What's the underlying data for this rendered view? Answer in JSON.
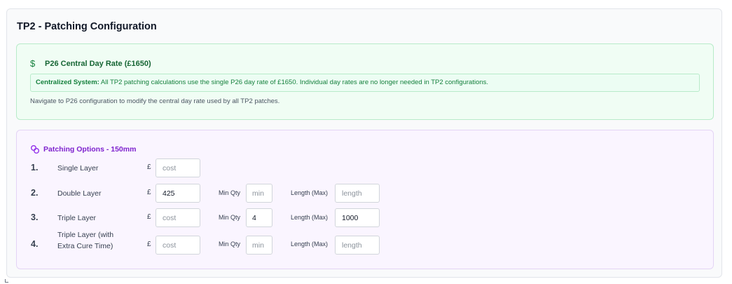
{
  "page": {
    "title": "TP2 - Patching Configuration"
  },
  "day_rate": {
    "icon": "dollar-icon",
    "title": "P26 Central Day Rate (£1650)",
    "notice_label": "Centralized System:",
    "notice_text": " All TP2 patching calculations use the single P26 day rate of £1650. Individual day rates are no longer needed in TP2 configurations.",
    "navigate_note": "Navigate to P26 configuration to modify the central day rate used by all TP2 patches.",
    "colors": {
      "accent": "#15803d",
      "background": "#f0fdf4",
      "border": "#b8ebc9"
    }
  },
  "patching": {
    "icon": "link-icon",
    "title": "Patching Options - 150mm",
    "currency_symbol": "£",
    "min_qty_label": "Min Qty",
    "length_label": "Length (Max)",
    "placeholders": {
      "cost": "cost",
      "min_qty": "min",
      "length": "length"
    },
    "colors": {
      "accent": "#7e22ce",
      "background": "#faf5ff",
      "border": "#e4d4f5"
    },
    "options": [
      {
        "number": "1.",
        "label": "Single Layer",
        "cost": ""
      },
      {
        "number": "2.",
        "label": "Double Layer",
        "cost": "425",
        "min_qty": "",
        "length": ""
      },
      {
        "number": "3.",
        "label": "Triple Layer",
        "cost": "",
        "min_qty": "4",
        "length": "1000"
      },
      {
        "number": "4.",
        "label_line1": "Triple Layer (with",
        "label_line2": "Extra Cure Time)",
        "cost": "",
        "min_qty": "",
        "length": ""
      }
    ]
  }
}
